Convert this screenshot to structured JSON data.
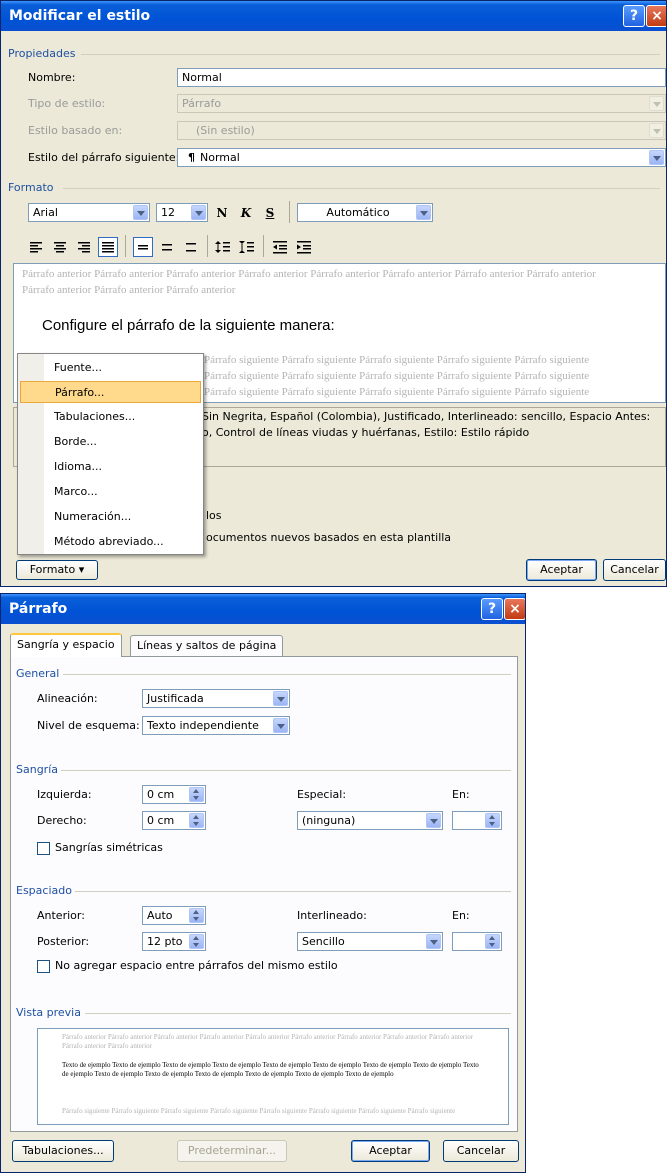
{
  "dialog1": {
    "title": "Modificar el estilo",
    "help": "?",
    "close": "×",
    "section_propiedades": "Propiedades",
    "nombre_label": "Nombre:",
    "nombre_value": "Normal",
    "tipo_label": "Tipo de estilo:",
    "tipo_value": "Párrafo",
    "basado_label": "Estilo basado en:",
    "basado_value": "(Sin estilo)",
    "siguiente_label": "Estilo del párrafo siguiente:",
    "siguiente_value": "Normal",
    "pilcrow": "¶",
    "section_formato": "Formato",
    "font_value": "Arial",
    "size_value": "12",
    "bold": "N",
    "italic": "K",
    "underline": "S",
    "color_value": "Automático",
    "preview_anterior": "Párrafo anterior Párrafo anterior Párrafo anterior Párrafo anterior Párrafo anterior Párrafo anterior Párrafo anterior Párrafo anterior Párrafo anterior Párrafo anterior Párrafo anterior",
    "preview_sample": "Configure el párrafo de la siguiente manera:",
    "preview_siguiente": "Párrafo siguiente Párrafo siguiente Párrafo siguiente Párrafo siguiente Párrafo siguiente",
    "description_line1": "Sin Negrita, Español (Colombia), Justificado, Interlineado:  sencillo, Espacio Antes:",
    "description_line2": "o, Control de líneas viudas y huérfanas, Estilo: Estilo rápido",
    "los_text": "los",
    "documentos_text": "ocumentos nuevos basados en esta plantilla",
    "formato_button": "Formato ▾",
    "aceptar": "Aceptar",
    "cancelar": "Cancelar",
    "menu": [
      "Fuente...",
      "Párrafo...",
      "Tabulaciones...",
      "Borde...",
      "Idioma...",
      "Marco...",
      "Numeración...",
      "Método abreviado..."
    ]
  },
  "dialog2": {
    "title": "Párrafo",
    "help": "?",
    "close": "×",
    "tab1": "Sangría y espacio",
    "tab2": "Líneas y saltos de página",
    "general": "General",
    "alineacion_label": "Alineación:",
    "alineacion_value": "Justificada",
    "nivel_label": "Nivel de esquema:",
    "nivel_value": "Texto independiente",
    "sangria": "Sangría",
    "izquierda_label": "Izquierda:",
    "izquierda_value": "0 cm",
    "derecho_label": "Derecho:",
    "derecho_value": "0 cm",
    "especial_label": "Especial:",
    "especial_value": "(ninguna)",
    "en_label": "En:",
    "simetricas_label": "Sangrías simétricas",
    "espaciado": "Espaciado",
    "anterior_label": "Anterior:",
    "anterior_value": "Auto",
    "posterior_label": "Posterior:",
    "posterior_value": "12 pto",
    "interlineado_label": "Interlineado:",
    "interlineado_value": "Sencillo",
    "en2_label": "En:",
    "noagregar_label": "No agregar espacio entre párrafos del mismo estilo",
    "vista_previa": "Vista previa",
    "vp_anterior": "Párrafo anterior Párrafo anterior Párrafo anterior Párrafo anterior Párrafo anterior Párrafo anterior Párrafo anterior Párrafo anterior Párrafo anterior Párrafo anterior Párrafo anterior",
    "vp_ejemplo": "Texto de ejemplo Texto de ejemplo Texto de ejemplo Texto de ejemplo Texto de ejemplo Texto de ejemplo Texto de ejemplo Texto de ejemplo Texto de ejemplo Texto de ejemplo Texto de ejemplo Texto de ejemplo Texto de ejemplo Texto de ejemplo Texto de ejemplo",
    "vp_siguiente": "Párrafo siguiente Párrafo siguiente Párrafo siguiente Párrafo siguiente Párrafo siguiente Párrafo siguiente Párrafo siguiente Párrafo siguiente",
    "tabulaciones_button": "Tabulaciones...",
    "predeterminar_button": "Predeterminar...",
    "aceptar": "Aceptar",
    "cancelar": "Cancelar"
  }
}
